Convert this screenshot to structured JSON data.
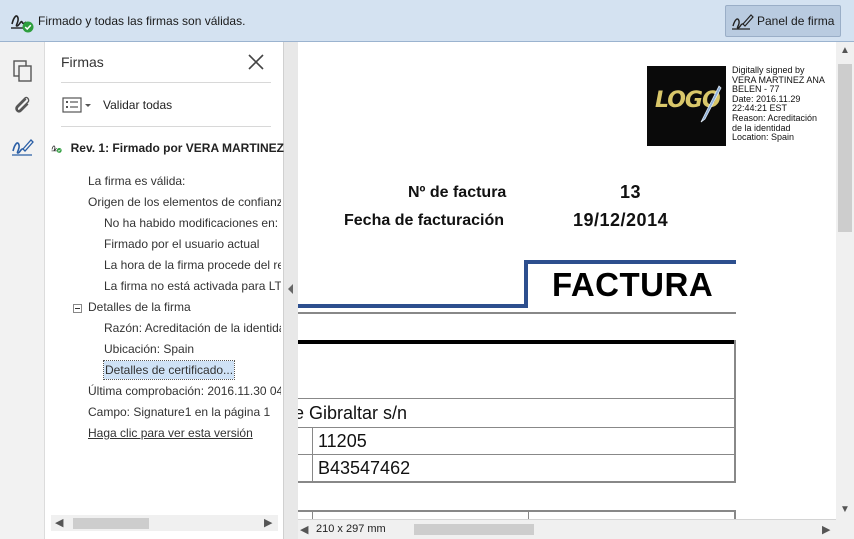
{
  "signature_bar": {
    "message": "Firmado y todas las firmas son válidas.",
    "panel_button_label": "Panel de firma"
  },
  "rail": {
    "icons": [
      "pages-icon",
      "attachment-icon",
      "signature-pen-icon"
    ]
  },
  "panel": {
    "title": "Firmas",
    "validate_all_label": "Validar todas",
    "revision_label": "Rev. 1: Firmado por VERA MARTINEZ",
    "tree": [
      {
        "level": 1,
        "text": "La firma es válida:"
      },
      {
        "level": 1,
        "text": "Origen de los elementos de confianza"
      },
      {
        "level": 2,
        "text": "No ha habido modificaciones en:"
      },
      {
        "level": 2,
        "text": "Firmado por el usuario actual"
      },
      {
        "level": 2,
        "text": "La hora de la firma procede del reloj"
      },
      {
        "level": 2,
        "text": "La firma no está activada para LTV"
      },
      {
        "level": 1,
        "text": "Detalles de la firma",
        "expandable": true
      },
      {
        "level": 2,
        "text": "Razón: Acreditación de la identidad"
      },
      {
        "level": 2,
        "text": "Ubicación: Spain"
      },
      {
        "level": 2,
        "text": "Detalles de certificado...",
        "selected": true
      },
      {
        "level": 1,
        "text": "Última comprobación: 2016.11.30 04"
      },
      {
        "level": 1,
        "text": "Campo: Signature1 en la página 1"
      },
      {
        "level": 1,
        "text": "Haga clic para ver esta versión",
        "link": true
      }
    ]
  },
  "document": {
    "signature_stamp": {
      "logo_text": "LOGO",
      "lines": [
        "Digitally signed by",
        "VERA MARTINEZ ANA",
        "BELEN - 77",
        "Date: 2016.11.29",
        "22:44:21 EST",
        "Reason: Acreditación",
        "de la identidad",
        "Location: Spain"
      ]
    },
    "invoice_number_label": "Nº de factura",
    "invoice_number": "13",
    "invoice_date_label": "Fecha de facturación",
    "invoice_date": "19/12/2014",
    "heading": "FACTURA",
    "address_fragment": "e Gibraltar s/n",
    "postal_code": "11205",
    "tax_id": "B43547462"
  },
  "status_bar": {
    "page_size": "210 x 297 mm"
  },
  "colors": {
    "signature_bar_bg": "#d4e2f1",
    "accent_blue": "#2d4f8e",
    "valid_green": "#2e9e3e"
  }
}
